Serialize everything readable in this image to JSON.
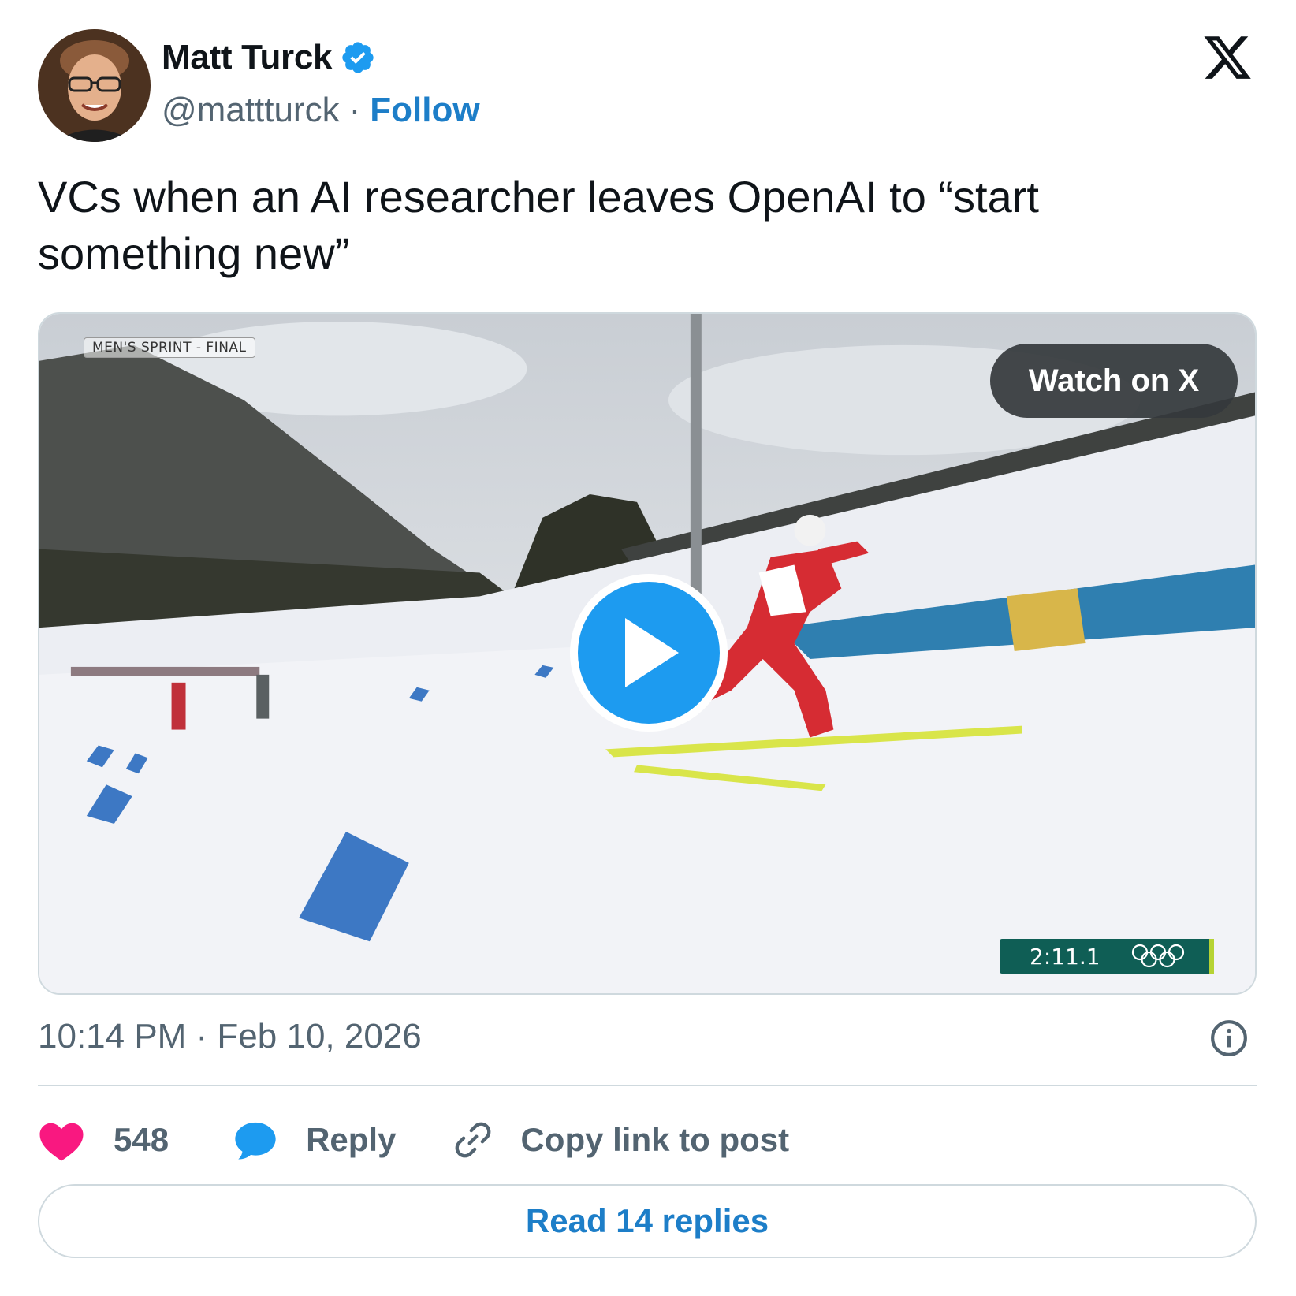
{
  "author": {
    "name": "Matt Turck",
    "handle": "@mattturck",
    "separator": "·",
    "follow_label": "Follow",
    "avatar_icon": "avatar-photo"
  },
  "brand": {
    "logo_icon": "x-logo-icon"
  },
  "tweet": {
    "text": "VCs when an AI researcher leaves OpenAI to “start something new”"
  },
  "media": {
    "type": "video",
    "overlay_label": "MEN'S SPRINT - FINAL",
    "watch_label": "Watch on X",
    "play_icon": "play-icon",
    "timer": "2:11.1"
  },
  "meta": {
    "timestamp": "10:14 PM · Feb 10, 2026",
    "info_icon": "info-icon"
  },
  "actions": {
    "like_count": "548",
    "reply_label": "Reply",
    "copy_label": "Copy link to post"
  },
  "read_replies_label": "Read 14 replies",
  "colors": {
    "accent": "#1d9bf0",
    "link": "#1d7ec8",
    "like": "#f91880",
    "muted": "#536471",
    "border": "#cfd9de"
  }
}
